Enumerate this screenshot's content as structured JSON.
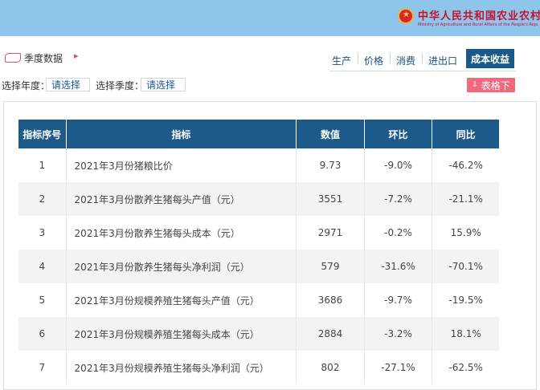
{
  "header": {
    "ministry_cn": "中华人民共和国农业农村部",
    "ministry_en": "Ministry of Agriculture and Rural Affairs of the People's Republic of China",
    "emblem_icon": "national-emblem-icon"
  },
  "section": {
    "title": "季度数据",
    "icon": "tag-icon",
    "arrow": "▸"
  },
  "tabs": [
    {
      "label": "生产"
    },
    {
      "label": "价格"
    },
    {
      "label": "消费"
    },
    {
      "label": "进出口"
    },
    {
      "label": "成本收益",
      "active": true
    }
  ],
  "filters": {
    "year_label": "选择年度：",
    "year_value": "请选择",
    "quarter_label": "选择季度：",
    "quarter_value": "请选择"
  },
  "export_button": {
    "label": "表格下",
    "icon": "download-icon"
  },
  "table": {
    "headers": [
      "指标序号",
      "指标",
      "数值",
      "环比",
      "同比"
    ],
    "rows": [
      [
        "1",
        "2021年3月份猪粮比价",
        "9.73",
        "-9.0%",
        "-46.2%"
      ],
      [
        "2",
        "2021年3月份散养生猪每头产值（元）",
        "3551",
        "-7.2%",
        "-21.1%"
      ],
      [
        "3",
        "2021年3月份散养生猪每头成本（元）",
        "2971",
        "-0.2%",
        "15.9%"
      ],
      [
        "4",
        "2021年3月份散养生猪每头净利润（元）",
        "579",
        "-31.6%",
        "-70.1%"
      ],
      [
        "5",
        "2021年3月份规模养殖生猪每头产值（元）",
        "3686",
        "-9.7%",
        "-19.5%"
      ],
      [
        "6",
        "2021年3月份规模养殖生猪每头成本（元）",
        "2884",
        "-3.2%",
        "18.1%"
      ],
      [
        "7",
        "2021年3月份规模养殖生猪每头净利润（元）",
        "802",
        "-27.1%",
        "-62.5%"
      ]
    ]
  },
  "colors": {
    "topbar": "#8ec5ea",
    "header_cell": "#1d5a8c",
    "active_tab": "#1a5a8a",
    "export": "#f06a7e",
    "brand_red": "#c8102e"
  }
}
